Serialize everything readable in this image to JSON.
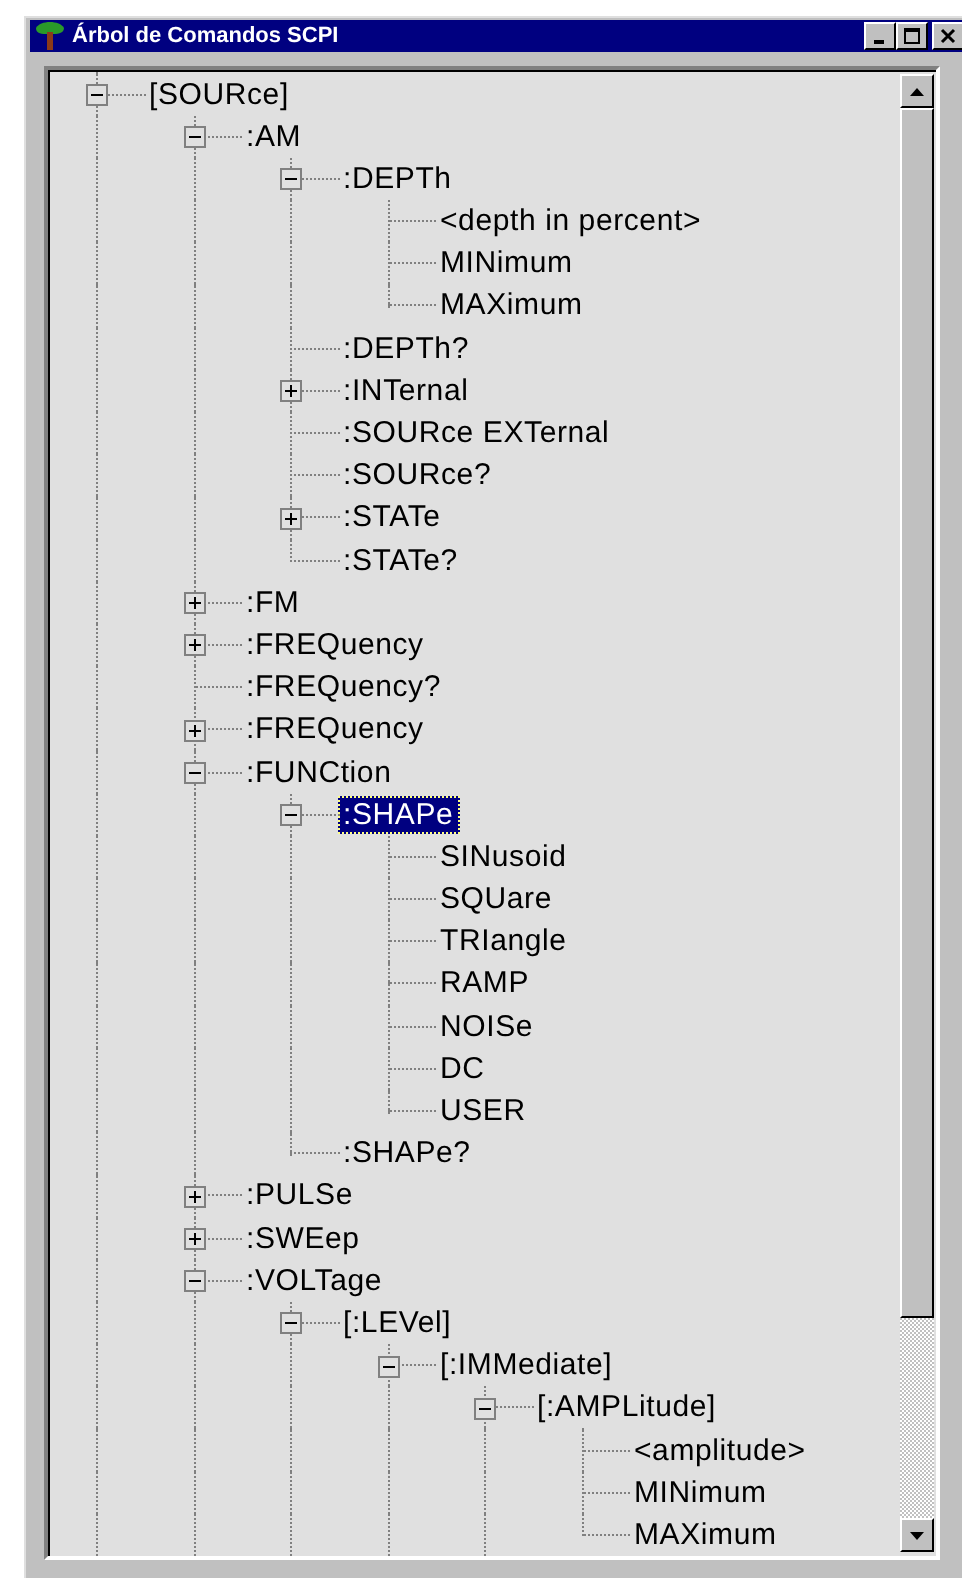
{
  "window": {
    "title": "Árbol de Comandos SCPI"
  },
  "tree": {
    "more_above": true,
    "more_below": true,
    "items": [
      {
        "label": "[SOURce]",
        "expanded": true,
        "selected": false,
        "more_children": true,
        "children": [
          {
            "label": ":AM",
            "expanded": true,
            "selected": false,
            "more_children": false,
            "children": [
              {
                "label": ":DEPTh",
                "expanded": true,
                "selected": false,
                "more_children": false,
                "children": [
                  {
                    "label": "<depth in percent>",
                    "selected": false
                  },
                  {
                    "label": "MINimum",
                    "selected": false
                  },
                  {
                    "label": "MAXimum",
                    "selected": false
                  }
                ]
              },
              {
                "label": ":DEPTh?",
                "selected": false
              },
              {
                "label": ":INTernal",
                "expanded": false,
                "selected": false
              },
              {
                "label": ":SOURce EXTernal",
                "selected": false
              },
              {
                "label": ":SOURce?",
                "selected": false
              },
              {
                "label": ":STATe",
                "expanded": false,
                "selected": false
              },
              {
                "label": ":STATe?",
                "selected": false
              }
            ]
          },
          {
            "label": ":FM",
            "expanded": false,
            "selected": false
          },
          {
            "label": ":FREQuency",
            "expanded": false,
            "selected": false
          },
          {
            "label": ":FREQuency?",
            "selected": false
          },
          {
            "label": ":FREQuency",
            "expanded": false,
            "selected": false
          },
          {
            "label": ":FUNCtion",
            "expanded": true,
            "selected": false,
            "more_children": false,
            "children": [
              {
                "label": ":SHAPe",
                "expanded": true,
                "selected": true,
                "more_children": false,
                "children": [
                  {
                    "label": "SINusoid",
                    "selected": false
                  },
                  {
                    "label": "SQUare",
                    "selected": false
                  },
                  {
                    "label": "TRIangle",
                    "selected": false
                  },
                  {
                    "label": "RAMP",
                    "selected": false
                  },
                  {
                    "label": "NOISe",
                    "selected": false
                  },
                  {
                    "label": "DC",
                    "selected": false
                  },
                  {
                    "label": "USER",
                    "selected": false
                  }
                ]
              },
              {
                "label": ":SHAPe?",
                "selected": false
              }
            ]
          },
          {
            "label": ":PULSe",
            "expanded": false,
            "selected": false
          },
          {
            "label": ":SWEep",
            "expanded": false,
            "selected": false
          },
          {
            "label": ":VOLTage",
            "expanded": true,
            "selected": false,
            "more_children": true,
            "children": [
              {
                "label": "[:LEVel]",
                "expanded": true,
                "selected": false,
                "more_children": true,
                "children": [
                  {
                    "label": "[:IMMediate]",
                    "expanded": true,
                    "selected": false,
                    "more_children": true,
                    "children": [
                      {
                        "label": "[:AMPLitude]",
                        "expanded": true,
                        "selected": false,
                        "more_children": false,
                        "children": [
                          {
                            "label": "<amplitude>",
                            "selected": false
                          },
                          {
                            "label": "MINimum",
                            "selected": false
                          },
                          {
                            "label": "MAXimum",
                            "selected": false
                          }
                        ]
                      }
                    ]
                  }
                ]
              }
            ]
          }
        ]
      }
    ]
  }
}
